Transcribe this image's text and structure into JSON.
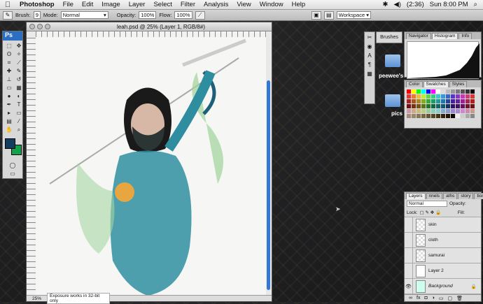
{
  "menubar": {
    "apple": "",
    "app": "Photoshop",
    "items": [
      "File",
      "Edit",
      "Image",
      "Layer",
      "Select",
      "Filter",
      "Analysis",
      "View",
      "Window",
      "Help"
    ],
    "battery": "(2:36)",
    "clock": "Sun 8:00 PM"
  },
  "options": {
    "brush_label": "Brush:",
    "brush_size": "9",
    "mode_label": "Mode:",
    "mode": "Normal",
    "opacity_label": "Opacity:",
    "opacity": "100%",
    "flow_label": "Flow:",
    "flow": "100%",
    "workspace": "Workspace ▾"
  },
  "toolbox": {
    "logo": "Ps"
  },
  "document": {
    "title": "leah.psd @ 25% (Layer 1, RGB/8#)",
    "zoom": "25%",
    "status": "Exposure works in 32-bit only"
  },
  "desktop": {
    "brushes_label": "Brushes",
    "folders": [
      "peewee's",
      "pics"
    ]
  },
  "panels": {
    "nav_tabs": [
      "Navigator",
      "Histogram",
      "Info"
    ],
    "swatch_tabs": [
      "Color",
      "Swatches",
      "Styles"
    ],
    "layer_tabs": [
      "Layers",
      "nnels",
      "aths",
      "story",
      "tions"
    ],
    "blend": "Normal",
    "opacity_label": "Opacity:",
    "lock_label": "Lock:",
    "fill_label": "Fill:"
  },
  "layers": [
    {
      "name": "skin"
    },
    {
      "name": "cloth"
    },
    {
      "name": "samurai"
    },
    {
      "name": "Layer 2"
    },
    {
      "name": "Background"
    }
  ],
  "colors": {
    "fg": "#123e5e",
    "bg": "#12a34a"
  }
}
